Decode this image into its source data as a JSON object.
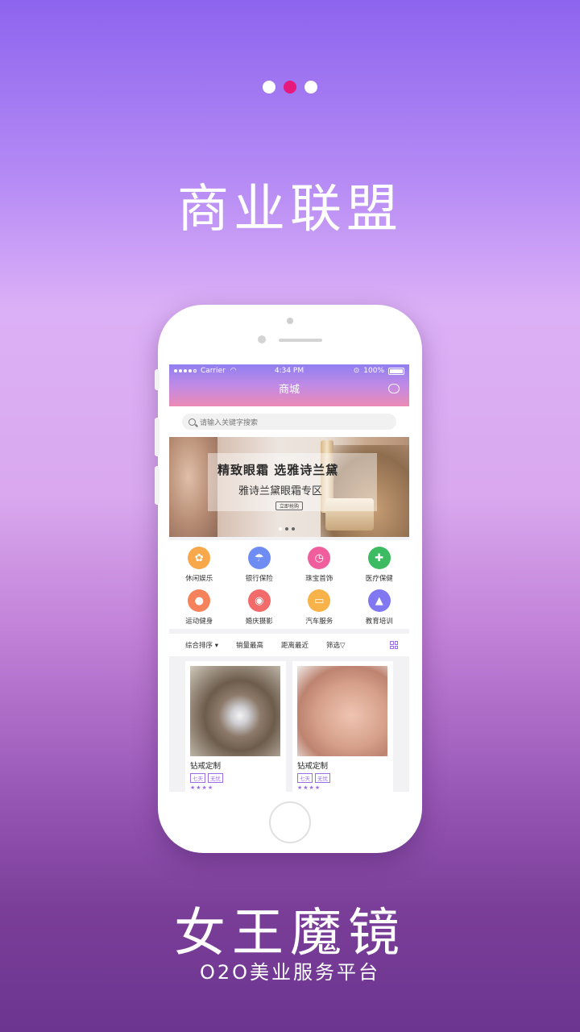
{
  "pager": {
    "count": 3,
    "active_index": 1
  },
  "headline": "商业联盟",
  "phone": {
    "status": {
      "carrier": "Carrier",
      "time": "4:34 PM",
      "battery": "100%"
    },
    "nav_title": "商城",
    "search": {
      "placeholder": "请输入关键字搜索"
    },
    "banner": {
      "title": "精致眼霜 选雅诗兰黛",
      "subtitle": "雅诗兰黛眼霜专区",
      "button": "立即抢购"
    },
    "categories": [
      {
        "label": "休闲娱乐",
        "color": "#f6a84a",
        "icon": "ticket-icon"
      },
      {
        "label": "银行保险",
        "color": "#6f8cf3",
        "icon": "umbrella-icon"
      },
      {
        "label": "珠宝首饰",
        "color": "#f05e9e",
        "icon": "watch-icon"
      },
      {
        "label": "医疗保健",
        "color": "#3dbb62",
        "icon": "medkit-icon"
      },
      {
        "label": "运动健身",
        "color": "#f5825a",
        "icon": "ball-icon"
      },
      {
        "label": "婚庆摄影",
        "color": "#f26a6a",
        "icon": "camera-icon"
      },
      {
        "label": "汽车服务",
        "color": "#f7b24a",
        "icon": "car-icon"
      },
      {
        "label": "教育培训",
        "color": "#7f78f0",
        "icon": "graduation-cap-icon"
      }
    ],
    "filters": {
      "sort": "综合排序",
      "sales": "销量最高",
      "distance": "距离最近",
      "screen": "筛选"
    },
    "products": [
      {
        "name": "钻戒定制",
        "tags": [
          "七天",
          "无忧"
        ],
        "rating": 4
      },
      {
        "name": "钻戒定制",
        "tags": [
          "七天",
          "无忧"
        ],
        "rating": 4
      }
    ]
  },
  "app_name": "女王魔镜",
  "slogan": "O2O美业服务平台",
  "colors": {
    "accent": "#9b6ee8",
    "pager_active": "#e6197d"
  }
}
